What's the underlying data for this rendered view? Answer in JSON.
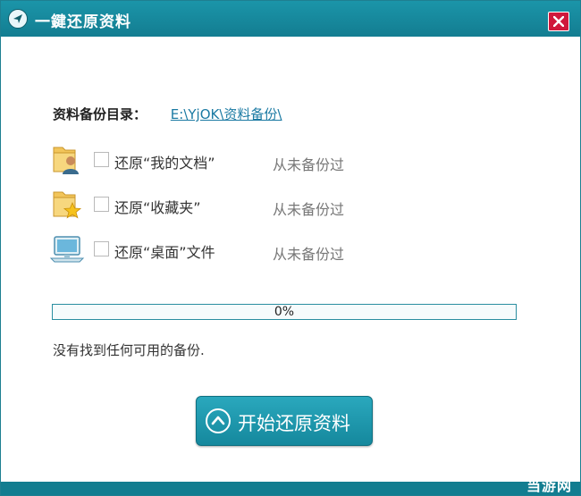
{
  "window": {
    "title": "一鍵还原资料",
    "close_icon": "close-x-icon",
    "app_icon": "app-logo-icon"
  },
  "backup_dir": {
    "label": "资料备份目录：",
    "path": "E:\\YjOK\\资料备份\\"
  },
  "items": [
    {
      "icon": "user-folder-icon",
      "label": "还原“我的文档”",
      "checked": false,
      "status": "从未备份过"
    },
    {
      "icon": "favorites-folder-icon",
      "label": "还原“收藏夹”",
      "checked": false,
      "status": "从未备份过"
    },
    {
      "icon": "desktop-monitor-icon",
      "label": "还原“桌面”文件",
      "checked": false,
      "status": "从未备份过"
    }
  ],
  "progress": {
    "value": 0,
    "text": "0%"
  },
  "message": "没有找到任何可用的备份.",
  "start_button": {
    "label": "开始还原资料",
    "icon": "up-arrow-circle-icon"
  },
  "watermark": "当游网",
  "colors": {
    "accent": "#1b95a9",
    "close": "#d0183b",
    "link": "#1b7aa3"
  }
}
